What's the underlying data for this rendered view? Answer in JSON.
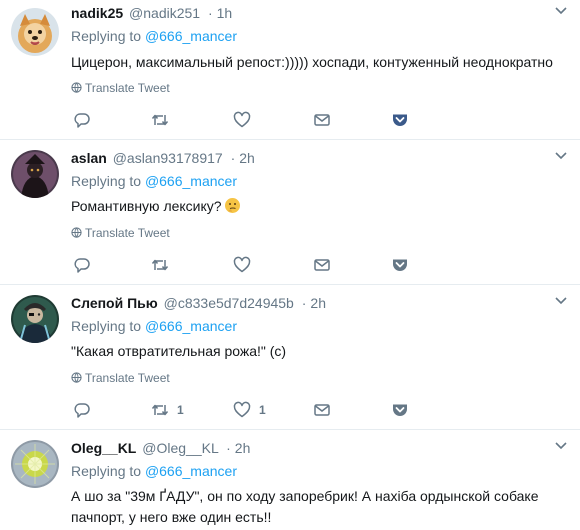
{
  "tweets": [
    {
      "name": "nadik25",
      "handle": "@nadik251",
      "dot": "·",
      "time": "1h",
      "replying_prefix": "Replying to",
      "replying_to": "@666_mancer",
      "text": "Цицерон, максимальный репост:))))) хоспади, контуженный неоднократно",
      "translate_label": "Translate Tweet",
      "retweet_count": "",
      "like_count": "",
      "avatar_icon": "pomeranian-dog-avatar"
    },
    {
      "name": "aslan",
      "handle": "@aslan93178917",
      "dot": "·",
      "time": "2h",
      "replying_prefix": "Replying to",
      "replying_to": "@666_mancer",
      "text": "Романтивную лексику?",
      "emoji_icon": "thinking-face-emoji",
      "translate_label": "Translate Tweet",
      "retweet_count": "",
      "like_count": "",
      "avatar_icon": "dark-figure-avatar"
    },
    {
      "name": "Слепой Пью",
      "handle": "@c833e5d7d24945b",
      "dot": "·",
      "time": "2h",
      "replying_prefix": "Replying to",
      "replying_to": "@666_mancer",
      "text": "\"Какая отвратительная рожа!\" (с)",
      "translate_label": "Translate Tweet",
      "retweet_count": "1",
      "like_count": "1",
      "avatar_icon": "pirate-character-avatar"
    },
    {
      "name": "Oleg__KL",
      "handle": "@Oleg__KL",
      "dot": "·",
      "time": "2h",
      "replying_prefix": "Replying to",
      "replying_to": "@666_mancer",
      "text": "А шо за \"39м ҐАДУ\", он по ходу запоребрик! А наxiба ордынской собаке пачпорт, у него вже один есть!!",
      "avatar_icon": "glowing-orb-avatar"
    }
  ],
  "colors": {
    "link": "#1da1f2",
    "secondary": "#657786",
    "divider": "#e6ecf0",
    "dm_active": "#3b5a8a"
  }
}
